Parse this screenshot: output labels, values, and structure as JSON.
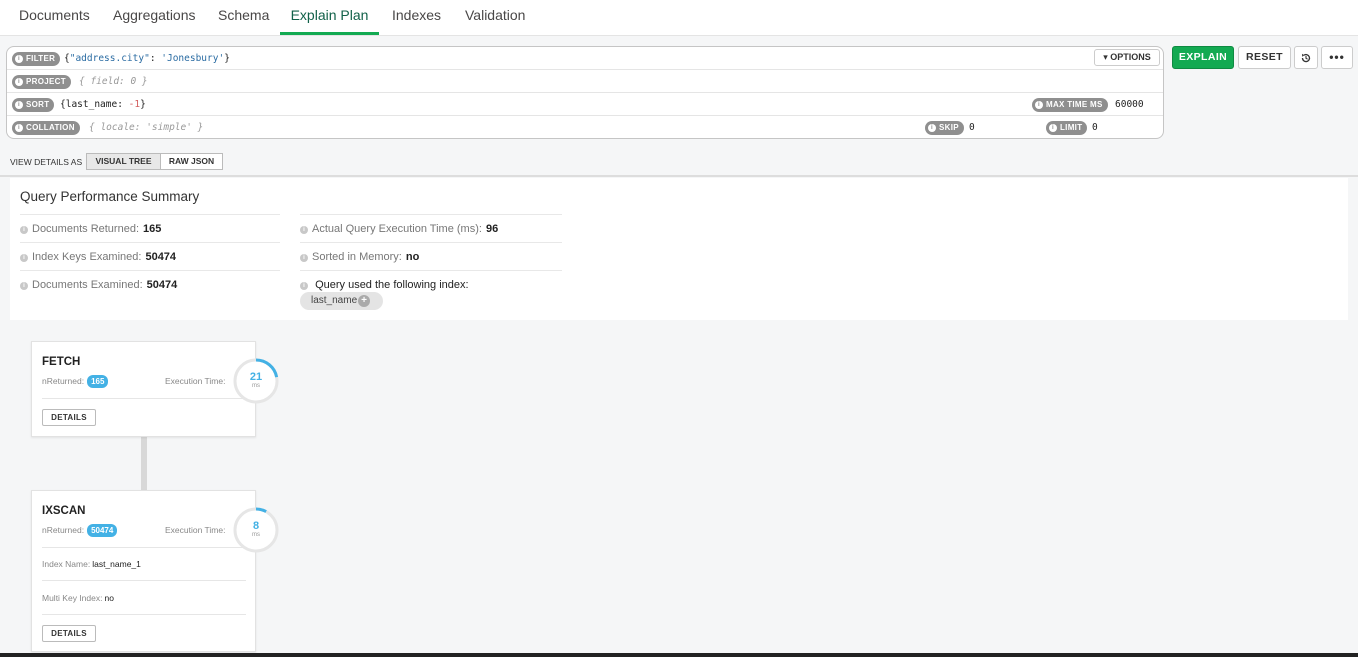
{
  "tabs": [
    {
      "label": "Documents"
    },
    {
      "label": "Aggregations"
    },
    {
      "label": "Schema"
    },
    {
      "label": "Explain Plan",
      "active": true
    },
    {
      "label": "Indexes"
    },
    {
      "label": "Validation"
    }
  ],
  "query": {
    "filter_label": "FILTER",
    "filter_open": "{",
    "filter_key": "\"address.city\"",
    "filter_colon": ": ",
    "filter_value": "'Jonesbury'",
    "filter_close": "}",
    "project_label": "PROJECT",
    "project_placeholder": "{ field: 0 }",
    "sort_label": "SORT",
    "sort_open": "{last_name: ",
    "sort_value": "-1",
    "sort_close": "}",
    "collation_label": "COLLATION",
    "collation_placeholder": "{ locale: 'simple' }",
    "options_label": "▾ OPTIONS",
    "max_time_label": "MAX TIME MS",
    "max_time_value": "60000",
    "skip_label": "SKIP",
    "skip_value": "0",
    "limit_label": "LIMIT",
    "limit_value": "0"
  },
  "buttons": {
    "explain": "EXPLAIN",
    "reset": "RESET",
    "history_icon": "history-icon",
    "more_icon": "ellipsis-icon"
  },
  "view": {
    "label": "VIEW DETAILS AS",
    "visual_tree": "VISUAL TREE",
    "raw_json": "RAW JSON",
    "selected": "VISUAL TREE"
  },
  "summary": {
    "title": "Query Performance Summary",
    "docs_returned_label": "Documents Returned:",
    "docs_returned": "165",
    "keys_examined_label": "Index Keys Examined:",
    "keys_examined": "50474",
    "docs_examined_label": "Documents Examined:",
    "docs_examined": "50474",
    "exec_time_label": "Actual Query Execution Time (ms):",
    "exec_time": "96",
    "sorted_label": "Sorted in Memory:",
    "sorted": "no",
    "index_used_label": "Query used the following index:",
    "index_name": "last_name"
  },
  "stages": [
    {
      "name": "FETCH",
      "nreturned_label": "nReturned:",
      "nreturned": "165",
      "exec_label": "Execution Time:",
      "exec_ms": "21",
      "ms_label": "ms",
      "details": "DETAILS",
      "exec_fraction": 0.22
    },
    {
      "name": "IXSCAN",
      "nreturned_label": "nReturned:",
      "nreturned": "50474",
      "exec_label": "Execution Time:",
      "exec_ms": "8",
      "ms_label": "ms",
      "index_name_label": "Index Name:",
      "index_name": "last_name_1",
      "multikey_label": "Multi Key Index:",
      "multikey": "no",
      "details": "DETAILS",
      "exec_fraction": 0.08
    }
  ],
  "colors": {
    "accent_green": "#13aa52",
    "accent_blue": "#43b1e5"
  }
}
